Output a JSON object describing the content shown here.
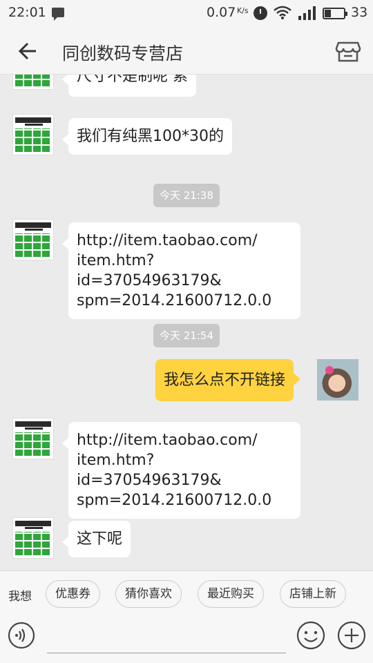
{
  "status_bar": {
    "time": "22:01",
    "network_speed": "0.07",
    "speed_unit": "K/s",
    "battery": "33"
  },
  "header": {
    "title": "同创数码专营店"
  },
  "messages": [
    {
      "from": "shop",
      "text": "尺寸不是制呢 索"
    },
    {
      "from": "shop",
      "text": "我们有纯黑100*30的"
    },
    {
      "timestamp": "今天 21:38"
    },
    {
      "from": "shop",
      "lines": [
        "http://item.taobao.com/",
        "item.htm?id=37054963179&",
        "spm=2014.21600712.0.0"
      ]
    },
    {
      "timestamp": "今天 21:54"
    },
    {
      "from": "me",
      "text": "我怎么点不开链接"
    },
    {
      "from": "shop",
      "lines": [
        "http://item.taobao.com/",
        "item.htm?id=37054963179&",
        "spm=2014.21600712.0.0"
      ]
    },
    {
      "from": "shop",
      "text": "这下呢"
    }
  ],
  "quick_bar": {
    "label": "我想",
    "chips": [
      "优惠券",
      "猜你喜欢",
      "最近购买",
      "店铺上新"
    ]
  },
  "input": {
    "placeholder": ""
  }
}
